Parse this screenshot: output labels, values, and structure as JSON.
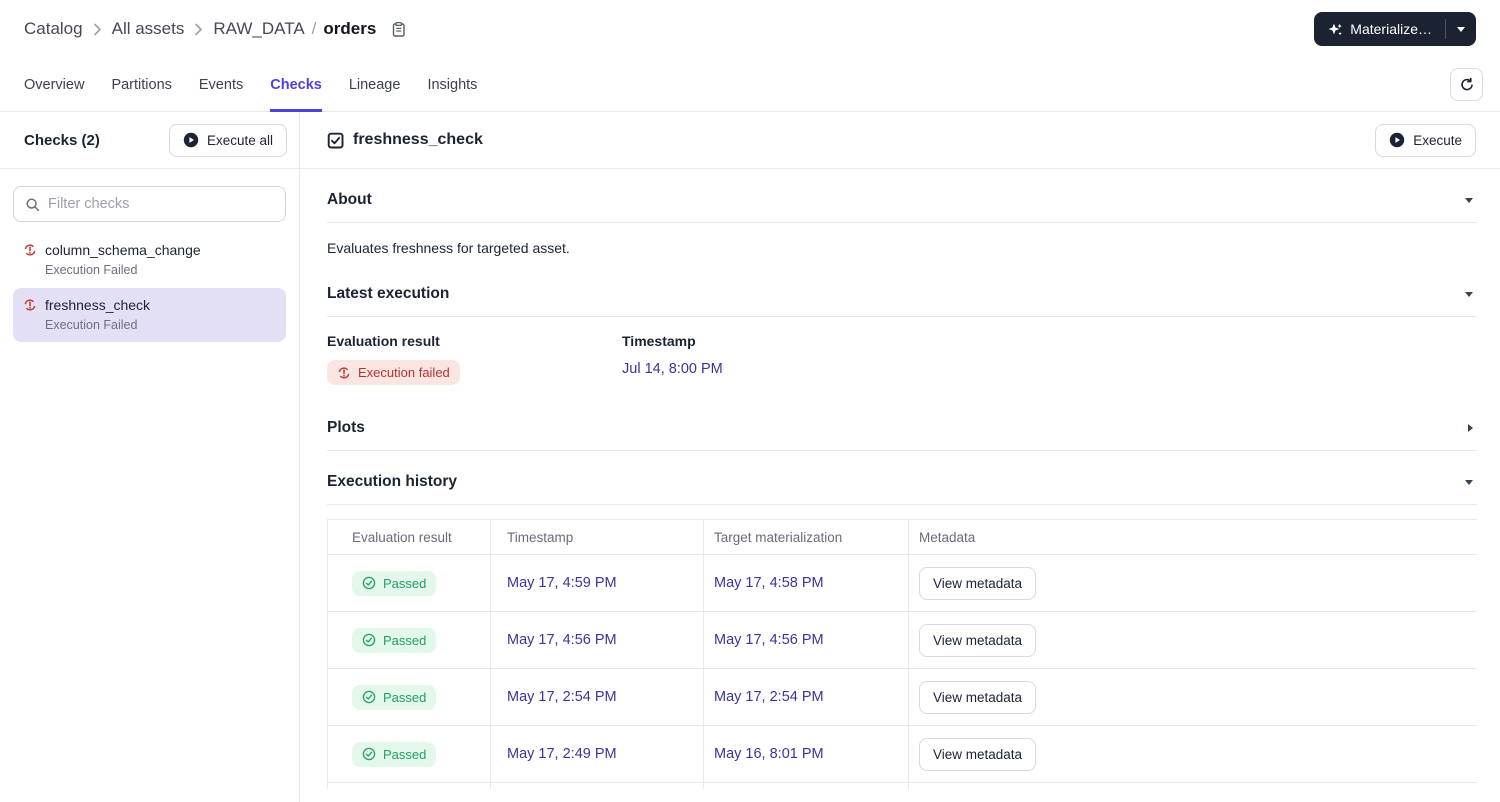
{
  "colors": {
    "accent": "#4E43D8",
    "link": "#3B339E",
    "dark_button_bg": "#1B2231",
    "failed_text": "#B3362E",
    "failed_bg": "#FAE5E3",
    "failed_icon": "#BE4138",
    "passed_text": "#21A065",
    "passed_bg": "#E4F7EB",
    "selected_item_bg": "#E3E0F6",
    "border": "#E7E9ED",
    "text_primary": "#1B2433",
    "text_secondary": "#6A7080"
  },
  "header": {
    "breadcrumb": {
      "catalog": "Catalog",
      "all_assets": "All assets",
      "group": "RAW_DATA",
      "separator": "/",
      "asset": "orders"
    },
    "materialize_label": "Materialize…"
  },
  "tabs": {
    "items": [
      {
        "label": "Overview"
      },
      {
        "label": "Partitions"
      },
      {
        "label": "Events"
      },
      {
        "label": "Checks"
      },
      {
        "label": "Lineage"
      },
      {
        "label": "Insights"
      }
    ],
    "active": "Checks"
  },
  "sidebar": {
    "title": "Checks (2)",
    "execute_all_label": "Execute all",
    "filter_placeholder": "Filter checks",
    "checks": [
      {
        "name": "column_schema_change",
        "status": "Execution Failed"
      },
      {
        "name": "freshness_check",
        "status": "Execution Failed"
      }
    ]
  },
  "main": {
    "title": "freshness_check",
    "execute_label": "Execute",
    "about": {
      "title": "About",
      "description": "Evaluates freshness for targeted asset."
    },
    "latest_execution": {
      "title": "Latest execution",
      "evaluation_label": "Evaluation result",
      "evaluation_value": "Execution failed",
      "timestamp_label": "Timestamp",
      "timestamp_value": "Jul 14, 8:00 PM"
    },
    "plots": {
      "title": "Plots"
    },
    "execution_history": {
      "title": "Execution history",
      "columns": {
        "evaluation": "Evaluation result",
        "timestamp": "Timestamp",
        "target": "Target materialization",
        "metadata": "Metadata"
      },
      "rows": [
        {
          "result": "Passed",
          "timestamp": "May 17, 4:59 PM",
          "target": "May 17, 4:58 PM",
          "action": "View metadata"
        },
        {
          "result": "Passed",
          "timestamp": "May 17, 4:56 PM",
          "target": "May 17, 4:56 PM",
          "action": "View metadata"
        },
        {
          "result": "Passed",
          "timestamp": "May 17, 2:54 PM",
          "target": "May 17, 2:54 PM",
          "action": "View metadata"
        },
        {
          "result": "Passed",
          "timestamp": "May 17, 2:49 PM",
          "target": "May 16, 8:01 PM",
          "action": "View metadata"
        }
      ]
    }
  }
}
